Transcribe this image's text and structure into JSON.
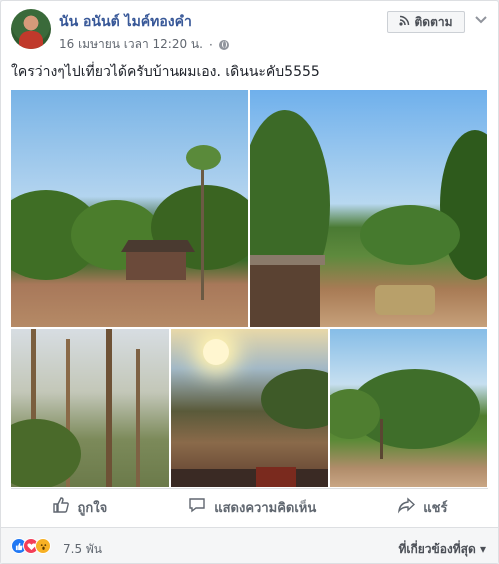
{
  "post": {
    "author": "นัน อนันต์ ไมค์ทองคำ",
    "timestamp": "16 เมษายน เวลา 12:20 น.",
    "separator": "·",
    "follow_label": "ติดตาม",
    "text": "ใครว่างๆไปเที่ยวได้ครับบ้านผมเอง. เดินนะคับ5555"
  },
  "actions": {
    "like": "ถูกใจ",
    "comment": "แสดงความคิดเห็น",
    "share": "แชร์"
  },
  "footer": {
    "reaction_count": "7.5 พัน",
    "sort_label": "ที่เกี่ยวข้องที่สุด ▾"
  },
  "icons": [
    "avatar",
    "rss-icon",
    "chevron-down-icon",
    "globe-icon",
    "like-icon",
    "comment-icon",
    "share-icon",
    "like-reaction-icon",
    "love-reaction-icon",
    "wow-reaction-icon"
  ],
  "colors": {
    "link": "#385898",
    "like": "#2078f4",
    "love": "#f33e58",
    "wow": "#f7b125"
  }
}
